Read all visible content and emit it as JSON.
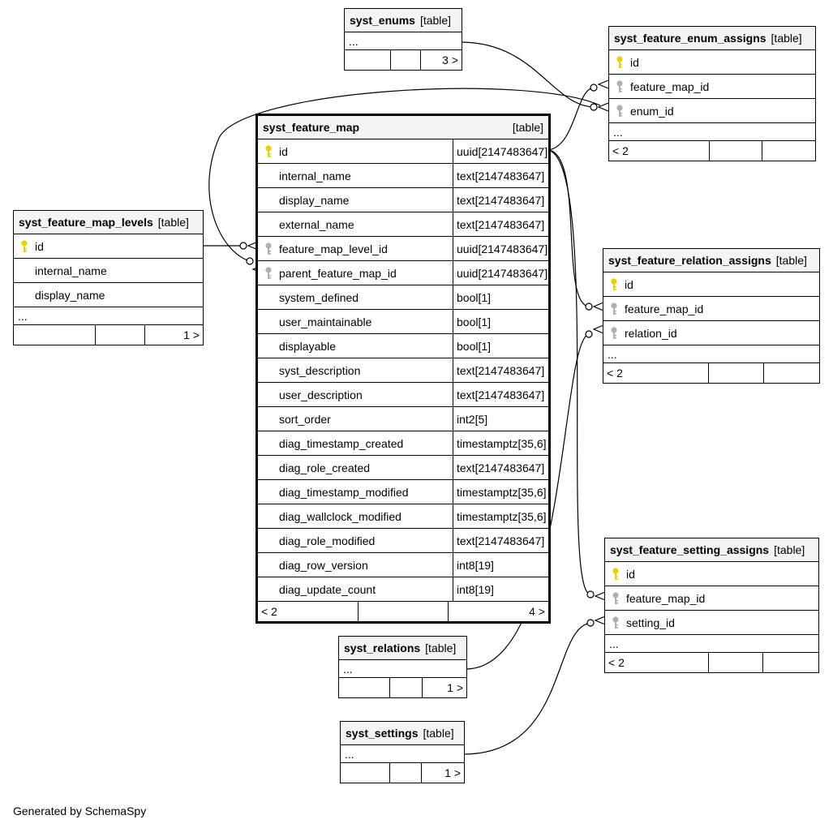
{
  "diagram": {
    "footer_text": "Generated by SchemaSpy",
    "colors": {
      "pk_key": "#e8d300",
      "fk_key": "#b0b0b0",
      "header_bg": "#f4f4f4"
    },
    "tables": {
      "syst_enums": {
        "name": "syst_enums",
        "type": "[table]",
        "ellipsis": "...",
        "foot": [
          "",
          "",
          "3 >"
        ]
      },
      "syst_feature_enum_assigns": {
        "name": "syst_feature_enum_assigns",
        "type": "[table]",
        "columns": [
          {
            "name": "id",
            "key": "pk"
          },
          {
            "name": "feature_map_id",
            "key": "fk"
          },
          {
            "name": "enum_id",
            "key": "fk"
          }
        ],
        "ellipsis": "...",
        "foot": [
          "< 2",
          "",
          ""
        ]
      },
      "syst_feature_map": {
        "name": "syst_feature_map",
        "type": "[table]",
        "columns": [
          {
            "name": "id",
            "type": "uuid[2147483647]",
            "key": "pk"
          },
          {
            "name": "internal_name",
            "type": "text[2147483647]",
            "key": ""
          },
          {
            "name": "display_name",
            "type": "text[2147483647]",
            "key": ""
          },
          {
            "name": "external_name",
            "type": "text[2147483647]",
            "key": ""
          },
          {
            "name": "feature_map_level_id",
            "type": "uuid[2147483647]",
            "key": "fk"
          },
          {
            "name": "parent_feature_map_id",
            "type": "uuid[2147483647]",
            "key": "fk"
          },
          {
            "name": "system_defined",
            "type": "bool[1]",
            "key": ""
          },
          {
            "name": "user_maintainable",
            "type": "bool[1]",
            "key": ""
          },
          {
            "name": "displayable",
            "type": "bool[1]",
            "key": ""
          },
          {
            "name": "syst_description",
            "type": "text[2147483647]",
            "key": ""
          },
          {
            "name": "user_description",
            "type": "text[2147483647]",
            "key": ""
          },
          {
            "name": "sort_order",
            "type": "int2[5]",
            "key": ""
          },
          {
            "name": "diag_timestamp_created",
            "type": "timestamptz[35,6]",
            "key": ""
          },
          {
            "name": "diag_role_created",
            "type": "text[2147483647]",
            "key": ""
          },
          {
            "name": "diag_timestamp_modified",
            "type": "timestamptz[35,6]",
            "key": ""
          },
          {
            "name": "diag_wallclock_modified",
            "type": "timestamptz[35,6]",
            "key": ""
          },
          {
            "name": "diag_role_modified",
            "type": "text[2147483647]",
            "key": ""
          },
          {
            "name": "diag_row_version",
            "type": "int8[19]",
            "key": ""
          },
          {
            "name": "diag_update_count",
            "type": "int8[19]",
            "key": ""
          }
        ],
        "foot": [
          "< 2",
          "",
          "4 >"
        ]
      },
      "syst_feature_map_levels": {
        "name": "syst_feature_map_levels",
        "type": "[table]",
        "columns": [
          {
            "name": "id",
            "key": "pk"
          },
          {
            "name": "internal_name",
            "key": ""
          },
          {
            "name": "display_name",
            "key": ""
          }
        ],
        "ellipsis": "...",
        "foot": [
          "",
          "",
          "1 >"
        ]
      },
      "syst_feature_relation_assigns": {
        "name": "syst_feature_relation_assigns",
        "type": "[table]",
        "columns": [
          {
            "name": "id",
            "key": "pk"
          },
          {
            "name": "feature_map_id",
            "key": "fk"
          },
          {
            "name": "relation_id",
            "key": "fk"
          }
        ],
        "ellipsis": "...",
        "foot": [
          "< 2",
          "",
          ""
        ]
      },
      "syst_feature_setting_assigns": {
        "name": "syst_feature_setting_assigns",
        "type": "[table]",
        "columns": [
          {
            "name": "id",
            "key": "pk"
          },
          {
            "name": "feature_map_id",
            "key": "fk"
          },
          {
            "name": "setting_id",
            "key": "fk"
          }
        ],
        "ellipsis": "...",
        "foot": [
          "< 2",
          "",
          ""
        ]
      },
      "syst_relations": {
        "name": "syst_relations",
        "type": "[table]",
        "ellipsis": "...",
        "foot": [
          "",
          "",
          "1 >"
        ]
      },
      "syst_settings": {
        "name": "syst_settings",
        "type": "[table]",
        "ellipsis": "...",
        "foot": [
          "",
          "",
          "1 >"
        ]
      }
    }
  }
}
